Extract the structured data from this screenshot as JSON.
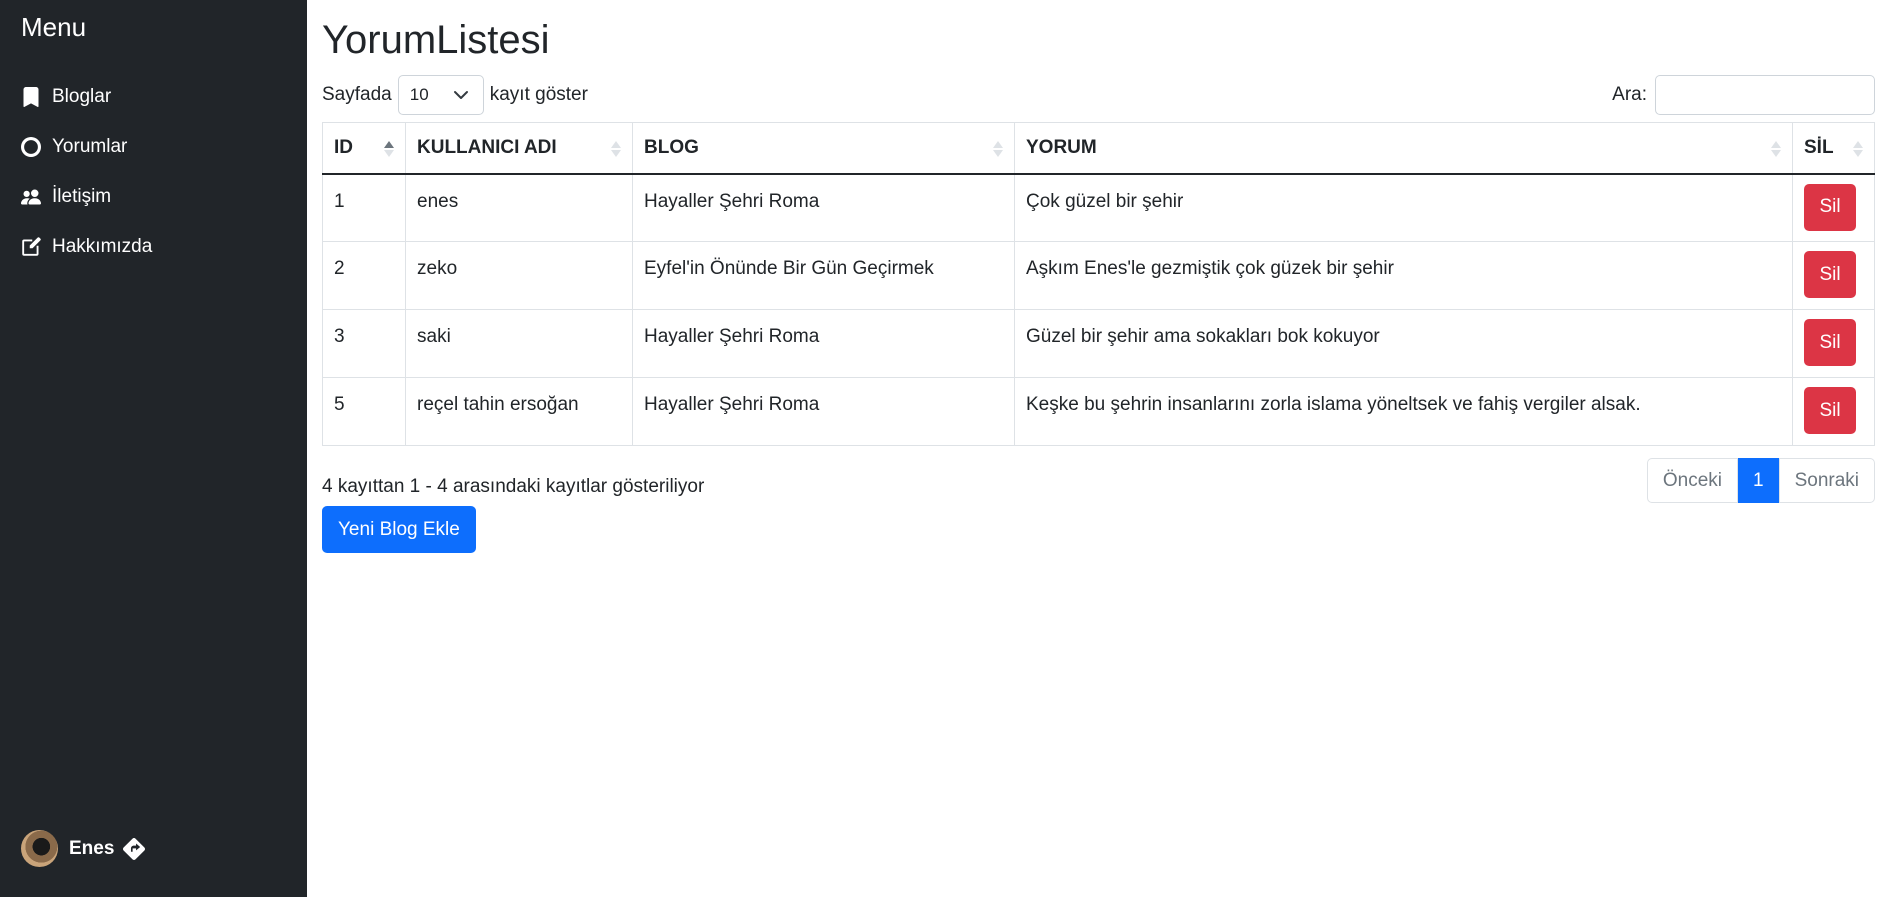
{
  "sidebar": {
    "title": "Menu",
    "items": [
      {
        "label": "Bloglar",
        "icon": "bookmark-icon"
      },
      {
        "label": "Yorumlar",
        "icon": "circle-icon"
      },
      {
        "label": "İletişim",
        "icon": "people-icon"
      },
      {
        "label": "Hakkımızda",
        "icon": "edit-icon"
      }
    ],
    "user": {
      "name": "Enes"
    }
  },
  "page": {
    "title": "YorumListesi",
    "length_prefix": "Sayfada",
    "length_value": "10",
    "length_suffix": "kayıt göster",
    "search_label": "Ara:",
    "search_value": ""
  },
  "table": {
    "columns": [
      "ID",
      "KULLANICI ADI",
      "BLOG",
      "YORUM",
      "SİL"
    ],
    "rows": [
      {
        "id": "1",
        "user": "enes",
        "blog": "Hayaller Şehri Roma",
        "comment": "Çok güzel bir şehir",
        "action": "Sil"
      },
      {
        "id": "2",
        "user": "zeko",
        "blog": "Eyfel'in Önünde Bir Gün Geçirmek",
        "comment": "Aşkım Enes'le gezmiştik çok güzek bir şehir",
        "action": "Sil"
      },
      {
        "id": "3",
        "user": "saki",
        "blog": "Hayaller Şehri Roma",
        "comment": "Güzel bir şehir ama sokakları bok kokuyor",
        "action": "Sil"
      },
      {
        "id": "5",
        "user": "reçel tahin ersoğan",
        "blog": "Hayaller Şehri Roma",
        "comment": "Keşke bu şehrin insanlarını zorla islama yöneltsek ve fahiş vergiler alsak.",
        "action": "Sil"
      }
    ]
  },
  "footer": {
    "info": "4 kayıttan 1 - 4 arasındaki kayıtlar gösteriliyor",
    "prev": "Önceki",
    "page": "1",
    "next": "Sonraki",
    "new_button": "Yeni Blog Ekle"
  },
  "colors": {
    "sidebar_bg": "#212529",
    "primary": "#0d6efd",
    "danger": "#dc3545"
  }
}
